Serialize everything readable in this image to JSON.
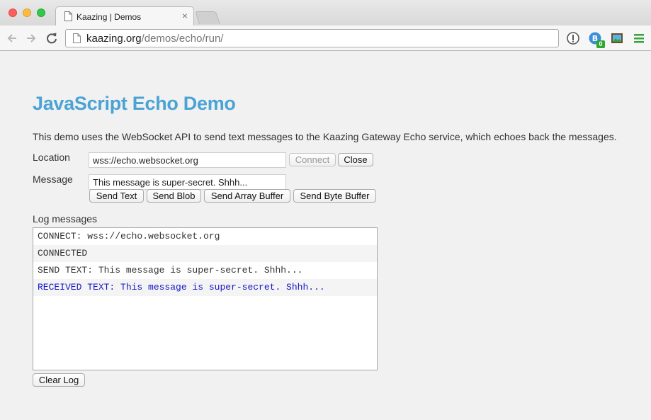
{
  "browser": {
    "tab_title": "Kaazing | Demos",
    "tab_close": "×",
    "url_host": "kaazing.org",
    "url_path": "/demos/echo/run/",
    "extension_badge": "0",
    "icons": [
      "back-arrow-icon",
      "forward-arrow-icon",
      "reload-icon",
      "page-icon",
      "info-icon",
      "blocker-icon",
      "screenshot-icon",
      "menu-icon"
    ]
  },
  "page": {
    "title": "JavaScript Echo Demo",
    "intro": "This demo uses the WebSocket API to send text messages to the Kaazing Gateway Echo service, which echoes back the messages.",
    "location": {
      "label": "Location",
      "value": "wss://echo.websocket.org",
      "connect_label": "Connect",
      "close_label": "Close"
    },
    "message": {
      "label": "Message",
      "value": "This message is super-secret. Shhh...",
      "send_text_label": "Send Text",
      "send_blob_label": "Send Blob",
      "send_array_buffer_label": "Send Array Buffer",
      "send_byte_buffer_label": "Send Byte Buffer"
    },
    "log": {
      "label": "Log messages",
      "lines": [
        "CONNECT: wss://echo.websocket.org",
        "CONNECTED",
        "SEND TEXT: This message is super-secret. Shhh...",
        "RECEIVED TEXT: This message is super-secret. Shhh..."
      ],
      "clear_label": "Clear Log"
    }
  },
  "colors": {
    "title": "#4aa3d5",
    "received_text": "#1515c8"
  }
}
